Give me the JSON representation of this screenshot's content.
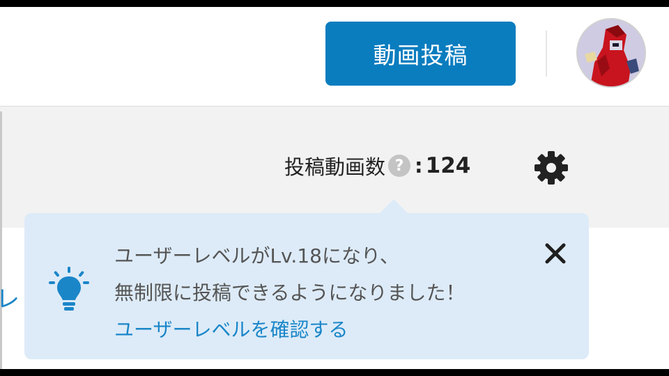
{
  "header": {
    "post_button_label": "動画投稿",
    "avatar_alt": "avatar"
  },
  "stats": {
    "label": "投稿動画数",
    "help_icon": "?",
    "colon": ":",
    "value": "124"
  },
  "side_fragment": "レ",
  "notice": {
    "line1": "ユーザーレベルがLv.18になり、",
    "line2": "無制限に投稿できるようになりました！",
    "link": "ユーザーレベルを確認する"
  },
  "icons": {
    "help": "question-circle-icon",
    "settings": "gear-icon",
    "tip": "lightbulb-icon",
    "close": "close-icon"
  },
  "colors": {
    "primary": "#0a7dbf",
    "link": "#1a86c8",
    "notice_bg": "#ddebf8",
    "band_bg": "#f2f2f2"
  }
}
